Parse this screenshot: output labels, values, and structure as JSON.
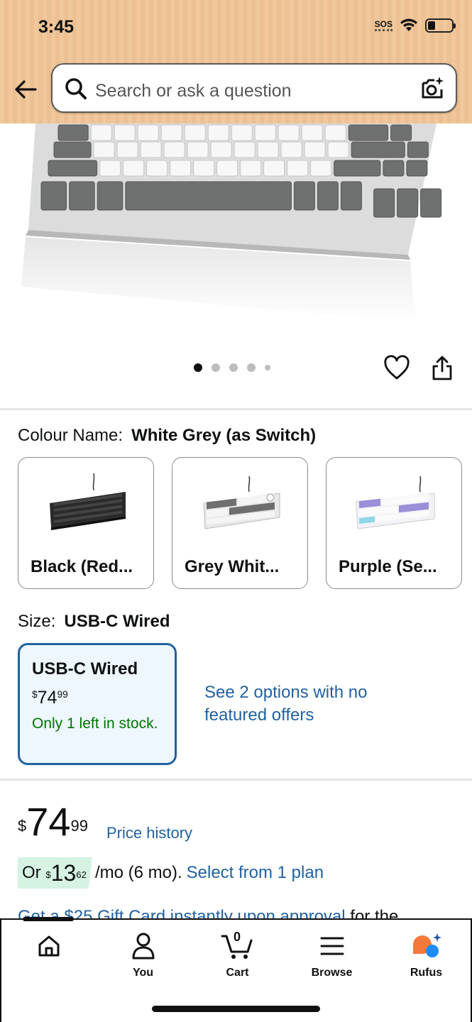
{
  "status_bar": {
    "time": "3:45",
    "sos": "SOS"
  },
  "search": {
    "placeholder": "Search or ask a question"
  },
  "colour": {
    "label": "Colour Name:",
    "selected": "White Grey (as Switch)",
    "options": [
      {
        "label": "Black (Red..."
      },
      {
        "label": "Grey Whit..."
      },
      {
        "label": "Purple (Se..."
      }
    ]
  },
  "size": {
    "label": "Size:",
    "selected": "USB-C Wired",
    "card": {
      "title": "USB-C Wired",
      "currency": "$",
      "price_whole": "74",
      "price_fraction": "99",
      "stock": "Only 1 left in stock."
    },
    "see_options": "See 2 options with no featured offers"
  },
  "price": {
    "currency": "$",
    "whole": "74",
    "fraction": "99",
    "history_link": "Price history"
  },
  "installment": {
    "prefix": "Or ",
    "currency": "$",
    "whole": "13",
    "fraction": "62",
    "terms": "/mo (6 mo).",
    "link": "Select from 1 plan"
  },
  "gift_card": {
    "link": "Get a $25 Gift Card instantly upon approval",
    "suffix": " for the"
  },
  "carousel": {
    "total_images": 5,
    "active_index": 0
  },
  "bottom_nav": {
    "items": [
      {
        "label": ""
      },
      {
        "label": "You"
      },
      {
        "label": "Cart",
        "badge": "0"
      },
      {
        "label": "Browse"
      },
      {
        "label": "Rufus"
      }
    ]
  },
  "colors": {
    "header_bg": "#f1c89b",
    "link": "#2162a1",
    "stock_green": "#007600",
    "selected_border": "#2162a1",
    "selected_bg": "#edf7fd",
    "installment_bg": "#d5f2e3",
    "rufus_orange": "#f5793a",
    "rufus_blue": "#1d8cf8"
  }
}
